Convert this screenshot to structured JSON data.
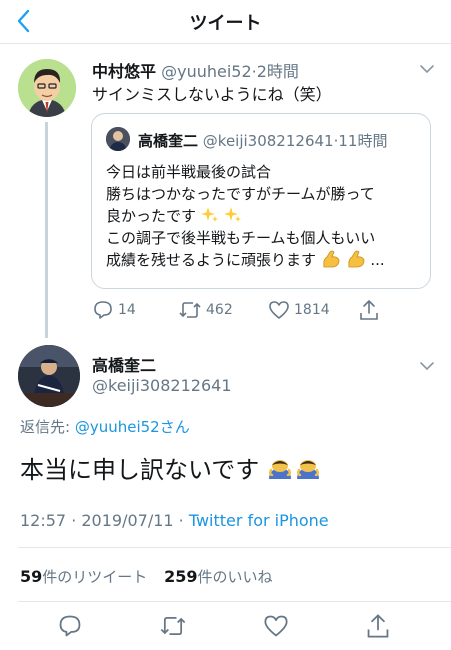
{
  "header": {
    "title": "ツイート"
  },
  "tweet1": {
    "display_name": "中村悠平",
    "handle": "@yuuhei52",
    "time": "2時間",
    "text": "サインミスしないようにね（笑）"
  },
  "quoted": {
    "display_name": "高橋奎二",
    "handle": "@keiji308212641",
    "time": "11時間",
    "lines": [
      "今日は前半戦最後の試合",
      "勝ちはつかなったですがチームが勝って",
      "良かったです",
      "この調子で後半戦もチームも個人もいい",
      "成績を残せるように頑張ります"
    ],
    "ellipsis": "..."
  },
  "tweet1_actions": {
    "replies": "14",
    "retweets": "462",
    "likes": "1814"
  },
  "tweet2": {
    "display_name": "高橋奎二",
    "handle": "@keiji308212641",
    "reply_prefix": "返信先: ",
    "reply_handle": "@yuuhei52",
    "reply_suffix": "さん",
    "text": "本当に申し訳ないです",
    "time": "12:57 · 2019/07/11 · ",
    "source": "Twitter for iPhone"
  },
  "stats": {
    "retweet_count": "59",
    "retweet_label": "件のリツイート",
    "like_count": "259",
    "like_label": "件のいいね"
  },
  "colors": {
    "link": "#1b95e0",
    "muted": "#657786",
    "text": "#14171a",
    "border": "#e1e8ed"
  },
  "icons": [
    "back-chevron-icon",
    "chevron-down-icon",
    "reply-icon",
    "retweet-icon",
    "like-icon",
    "share-icon",
    "sparkles-emoji",
    "flexed-biceps-emoji",
    "bowing-person-emoji"
  ]
}
